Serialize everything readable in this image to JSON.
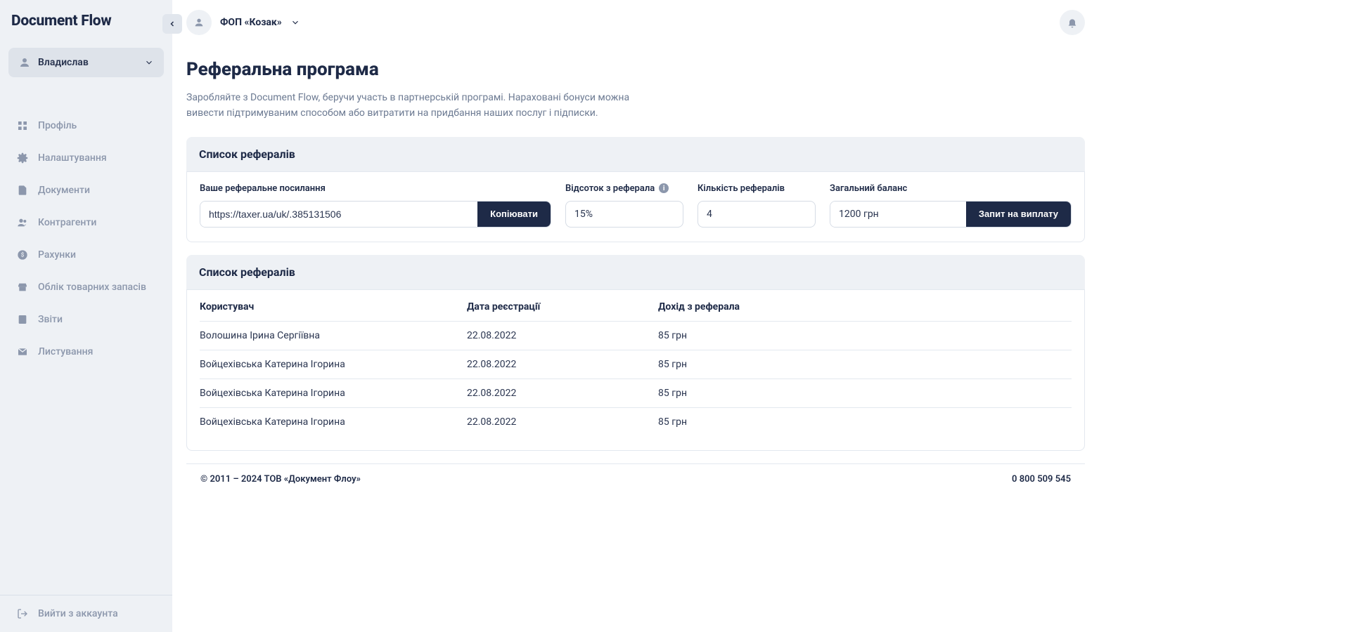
{
  "app": {
    "name": "Document Flow"
  },
  "sidebar": {
    "user_name": "Владислав",
    "items": [
      {
        "label": "Профіль"
      },
      {
        "label": "Налаштування"
      },
      {
        "label": "Документи"
      },
      {
        "label": "Контрагенти"
      },
      {
        "label": "Рахунки"
      },
      {
        "label": "Облік товарних запасів"
      },
      {
        "label": "Звіти"
      },
      {
        "label": "Листування"
      }
    ],
    "logout": "Вийти з аккаунта"
  },
  "header": {
    "org_name": "ФОП «Козак»"
  },
  "page": {
    "title": "Реферальна програма",
    "description": "Заробляйте з Document Flow, беручи участь в партнерській програмі. Нараховані бонуси можна вивести підтримуваним способом або витратити на придбання наших послуг і підписки."
  },
  "referral_stats": {
    "section_title": "Список рефералів",
    "link_label": "Ваше реферальне посилання",
    "link_value": "https://taxer.ua/uk/.385131506",
    "copy_btn": "Копіювати",
    "percent_label": "Відсоток з реферала",
    "percent_value": "15%",
    "count_label": "Кількість рефералів",
    "count_value": "4",
    "balance_label": "Загальний баланс",
    "balance_value": "1200 грн",
    "payout_btn": "Запит на виплату"
  },
  "referral_list": {
    "section_title": "Список рефералів",
    "columns": {
      "user": "Користувач",
      "date": "Дата реєстрації",
      "income": "Дохід з реферала"
    },
    "rows": [
      {
        "user": "Волошина Ірина Сергіївна",
        "date": "22.08.2022",
        "income": "85 грн"
      },
      {
        "user": "Войцехівська Катерина Ігорина",
        "date": "22.08.2022",
        "income": "85 грн"
      },
      {
        "user": "Войцехівська Катерина Ігорина",
        "date": "22.08.2022",
        "income": "85 грн"
      },
      {
        "user": "Войцехівська Катерина Ігорина",
        "date": "22.08.2022",
        "income": "85 грн"
      }
    ]
  },
  "footer": {
    "copyright": "© 2011 – 2024 ТОВ «Документ Флоу»",
    "phone": "0 800 509 545"
  }
}
